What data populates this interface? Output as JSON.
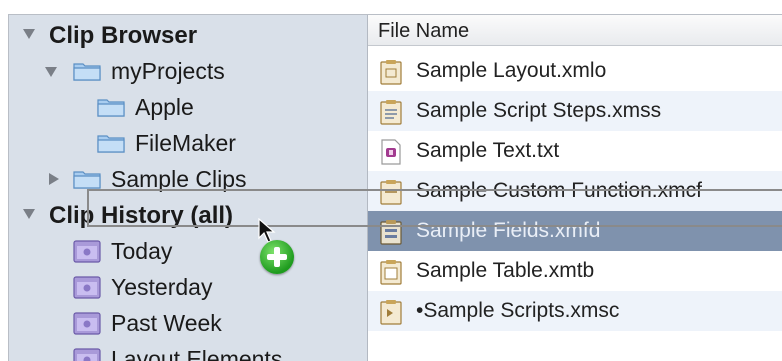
{
  "sidebar": {
    "clip_browser": "Clip Browser",
    "my_projects": "myProjects",
    "apple": "Apple",
    "filemaker": "FileMaker",
    "sample_clips": "Sample Clips",
    "clip_history": "Clip History (all)",
    "today": "Today",
    "yesterday": "Yesterday",
    "past_week": "Past Week",
    "layout_elements": "Layout Elements"
  },
  "list": {
    "column_header": "File Name",
    "rows": [
      {
        "name": "Sample Layout.xmlo",
        "icon": "layout-doc-icon"
      },
      {
        "name": "Sample Script Steps.xmss",
        "icon": "script-steps-doc-icon"
      },
      {
        "name": "Sample Text.txt",
        "icon": "text-doc-icon"
      },
      {
        "name": "Sample Custom Function.xmcf",
        "icon": "custom-function-doc-icon"
      },
      {
        "name": "Sample Fields.xmfd",
        "icon": "fields-doc-icon"
      },
      {
        "name": "Sample Table.xmtb",
        "icon": "table-doc-icon"
      },
      {
        "name": "•Sample Scripts.xmsc",
        "icon": "scripts-doc-icon"
      }
    ]
  },
  "colors": {
    "sidebar_bg": "#d9e0e9",
    "selection": "#7f92ad",
    "alt_row": "#eef3fa",
    "add_badge": "#2aa52a"
  }
}
